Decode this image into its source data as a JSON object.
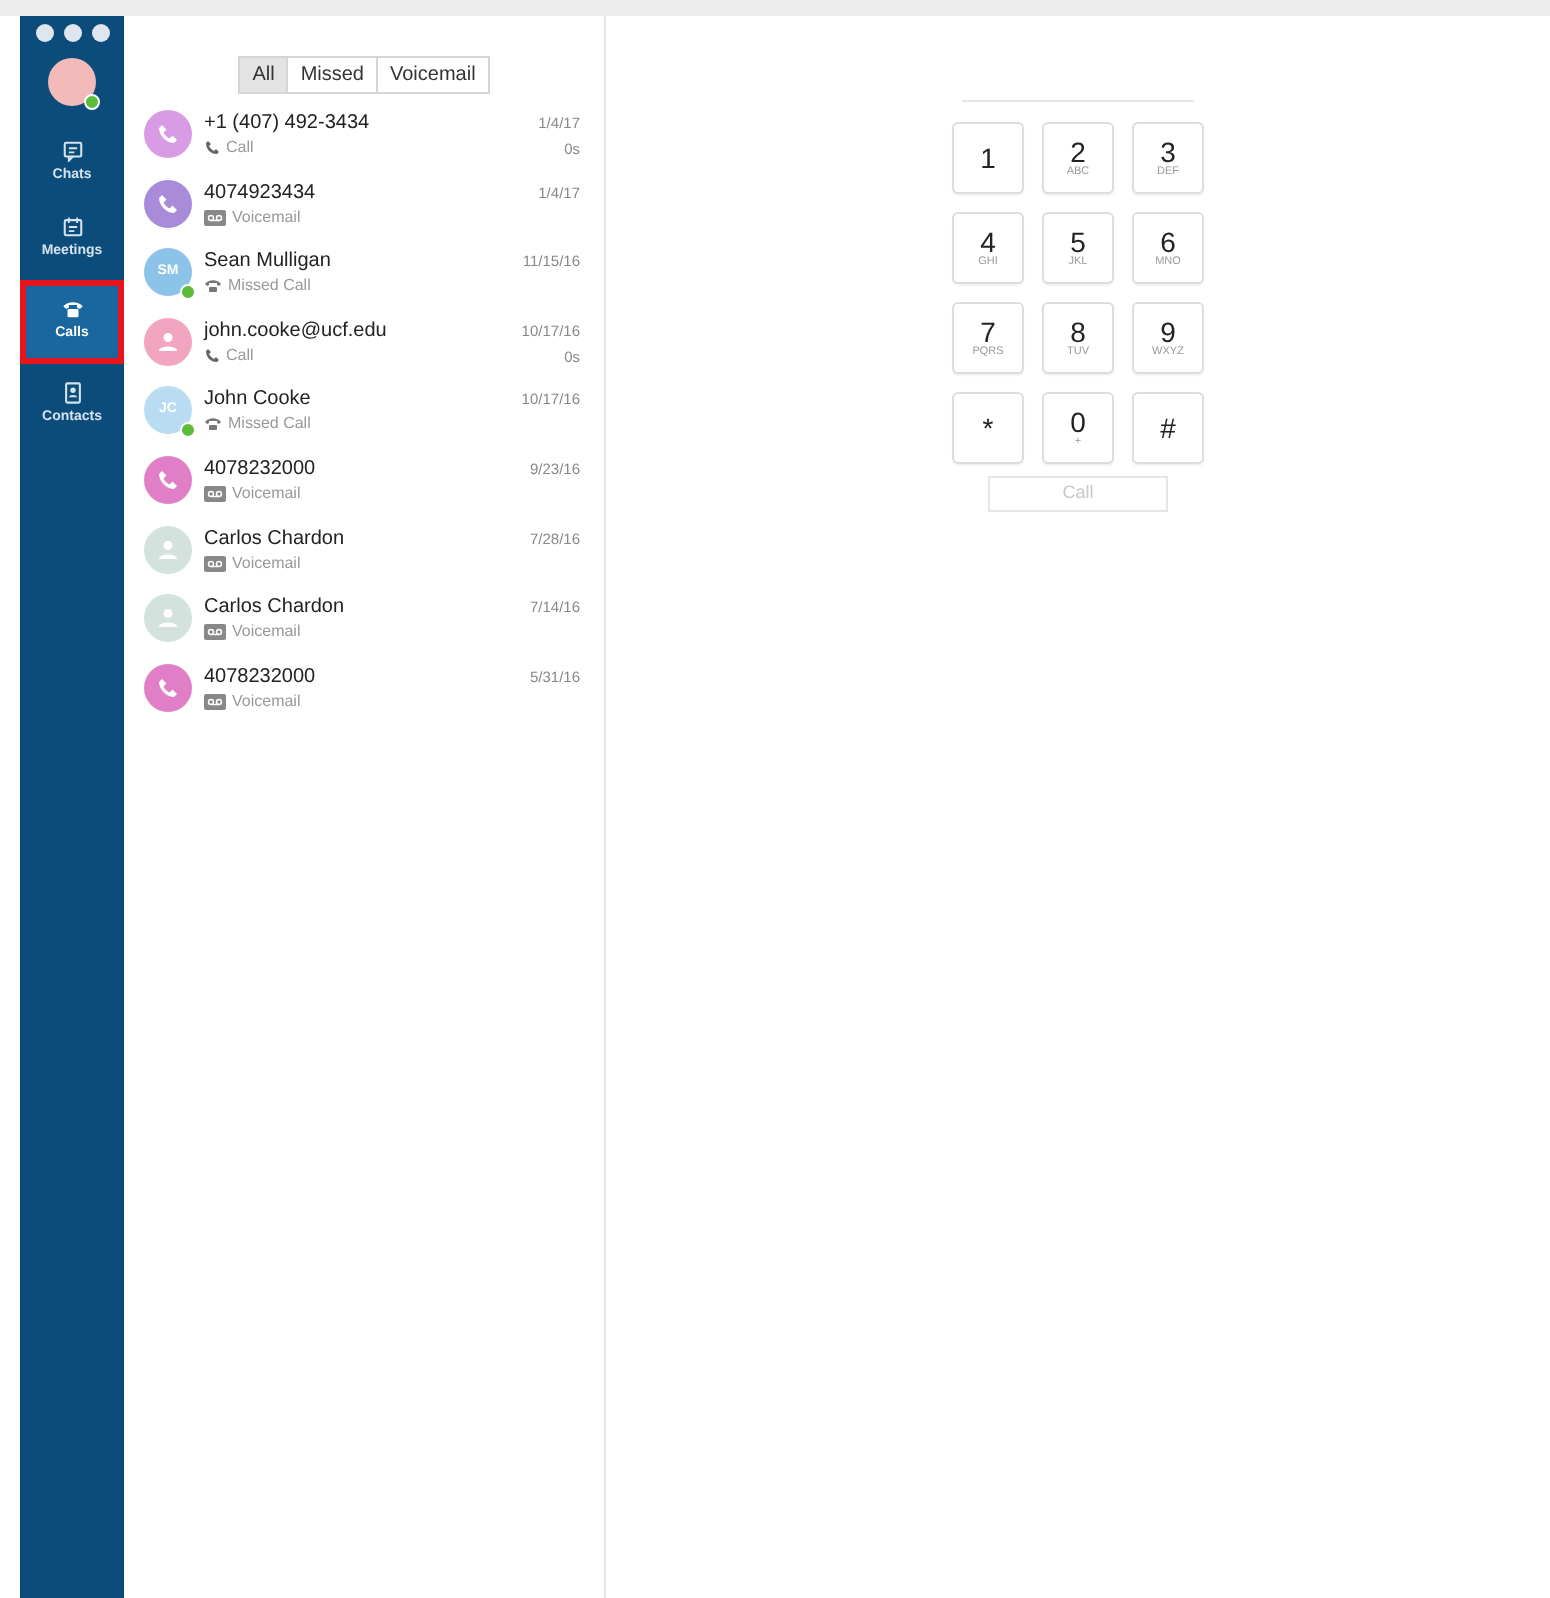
{
  "sidebar": {
    "user": {
      "online": true
    },
    "items": [
      {
        "label": "Chats",
        "selected": false,
        "highlighted": false
      },
      {
        "label": "Meetings",
        "selected": false,
        "highlighted": false
      },
      {
        "label": "Calls",
        "selected": true,
        "highlighted": true
      },
      {
        "label": "Contacts",
        "selected": false,
        "highlighted": false
      }
    ]
  },
  "filter_tabs": [
    {
      "label": "All",
      "selected": true
    },
    {
      "label": "Missed",
      "selected": false
    },
    {
      "label": "Voicemail",
      "selected": false
    }
  ],
  "calls": [
    {
      "name": "+1 (407) 492-3434",
      "type": "Call",
      "kind": "call",
      "avatar": {
        "kind": "phone",
        "color": "#d99be3",
        "online": false
      },
      "date": "1/4/17",
      "duration": "0s"
    },
    {
      "name": "4074923434",
      "type": "Voicemail",
      "kind": "voicemail",
      "avatar": {
        "kind": "phone",
        "color": "#a98bd9",
        "online": false
      },
      "date": "1/4/17"
    },
    {
      "name": "Sean Mulligan",
      "type": "Missed Call",
      "kind": "missed",
      "avatar": {
        "kind": "initials",
        "initials": "SM",
        "color": "#8cc3e8",
        "online": true
      },
      "date": "11/15/16"
    },
    {
      "name": "john.cooke@ucf.edu",
      "type": "Call",
      "kind": "call",
      "avatar": {
        "kind": "person",
        "color": "#f2a5c0",
        "online": false
      },
      "date": "10/17/16",
      "duration": "0s"
    },
    {
      "name": "John Cooke",
      "type": "Missed Call",
      "kind": "missed",
      "avatar": {
        "kind": "initials",
        "initials": "JC",
        "color": "#b9dcf2",
        "online": true
      },
      "date": "10/17/16"
    },
    {
      "name": "4078232000",
      "type": "Voicemail",
      "kind": "voicemail",
      "avatar": {
        "kind": "phone",
        "color": "#e07fc7",
        "online": false
      },
      "date": "9/23/16"
    },
    {
      "name": "Carlos Chardon",
      "type": "Voicemail",
      "kind": "voicemail",
      "avatar": {
        "kind": "person",
        "color": "#d3e2dc",
        "online": false
      },
      "date": "7/28/16"
    },
    {
      "name": "Carlos Chardon",
      "type": "Voicemail",
      "kind": "voicemail",
      "avatar": {
        "kind": "person",
        "color": "#d3e2dc",
        "online": false
      },
      "date": "7/14/16"
    },
    {
      "name": "4078232000",
      "type": "Voicemail",
      "kind": "voicemail",
      "avatar": {
        "kind": "phone",
        "color": "#e07fc7",
        "online": false
      },
      "date": "5/31/16"
    }
  ],
  "dialpad": {
    "keys": [
      {
        "digit": "1"
      },
      {
        "digit": "2",
        "letters": "ABC"
      },
      {
        "digit": "3",
        "letters": "DEF"
      },
      {
        "digit": "4",
        "letters": "GHI"
      },
      {
        "digit": "5",
        "letters": "JKL"
      },
      {
        "digit": "6",
        "letters": "MNO"
      },
      {
        "digit": "7",
        "letters": "PQRS"
      },
      {
        "digit": "8",
        "letters": "TUV"
      },
      {
        "digit": "9",
        "letters": "WXYZ"
      },
      {
        "digit": "*"
      },
      {
        "digit": "0",
        "letters": "+"
      },
      {
        "digit": "#"
      }
    ],
    "call_button": {
      "label": "Call",
      "disabled": true
    }
  }
}
